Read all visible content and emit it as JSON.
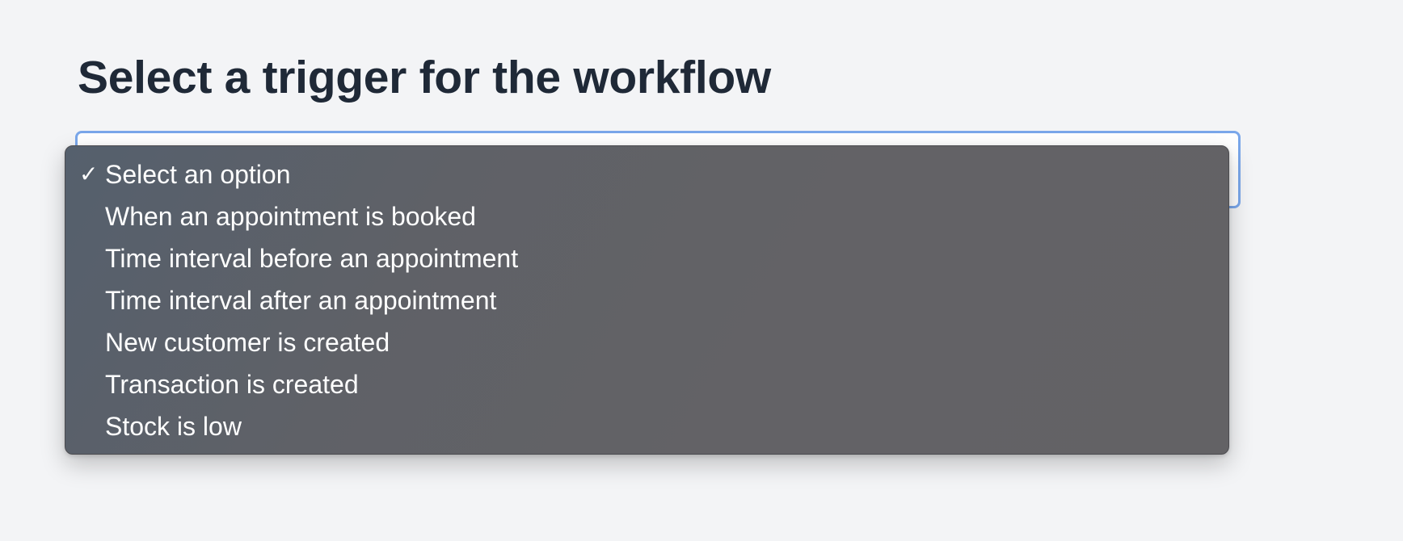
{
  "page": {
    "title": "Select a trigger for the workflow"
  },
  "dropdown": {
    "selected_index": 0,
    "options": [
      "Select an option",
      "When an appointment is booked",
      "Time interval before an appointment",
      "Time interval after an appointment",
      "New customer is created",
      "Transaction is created",
      "Stock is low"
    ]
  },
  "colors": {
    "focus_ring": "#7aa7ea",
    "menu_background": "#636266",
    "title_text": "#1f2937"
  }
}
